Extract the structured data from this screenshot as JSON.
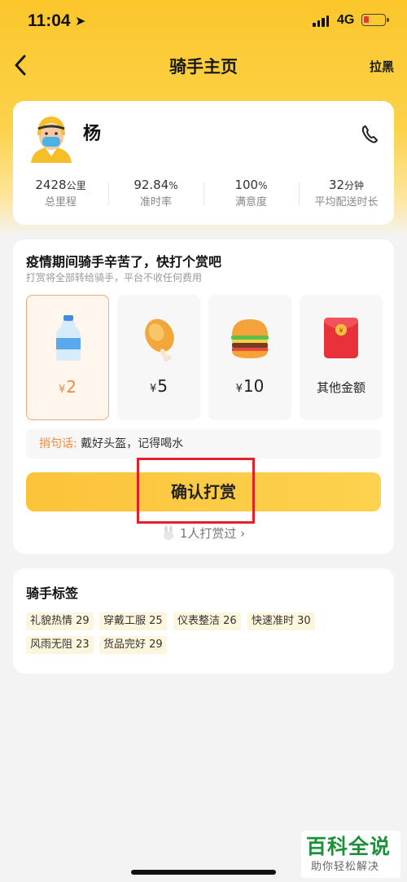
{
  "status_bar": {
    "time": "11:04",
    "network": "4G",
    "battery_color": "#e53935"
  },
  "nav": {
    "title": "骑手主页",
    "right_label": "拉黑"
  },
  "rider": {
    "name": "杨",
    "stats": [
      {
        "value": "2428",
        "unit": "公里",
        "label": "总里程"
      },
      {
        "value": "92.84",
        "unit": "%",
        "label": "准时率"
      },
      {
        "value": "100",
        "unit": "%",
        "label": "满意度"
      },
      {
        "value": "32",
        "unit": "分钟",
        "label": "平均配送时长"
      }
    ]
  },
  "tip": {
    "heading": "疫情期间骑手辛苦了，快打个赏吧",
    "subheading": "打赏将全部转给骑手，平台不收任何费用",
    "options": [
      {
        "icon": "water-bottle-icon",
        "currency": "¥",
        "amount": "2",
        "selected": true
      },
      {
        "icon": "chicken-leg-icon",
        "currency": "¥",
        "amount": "5",
        "selected": false
      },
      {
        "icon": "burger-icon",
        "currency": "¥",
        "amount": "10",
        "selected": false
      },
      {
        "icon": "red-envelope-icon",
        "label": "其他金额",
        "selected": false
      }
    ],
    "message_key": "捎句话:",
    "message_text": "戴好头盔，记得喝水",
    "confirm_label": "确认打赏",
    "tipped_count_label": "1人打赏过",
    "tipped_chevron": "›"
  },
  "tags": {
    "heading": "骑手标签",
    "items": [
      "礼貌热情 29",
      "穿戴工服 25",
      "仪表整洁 26",
      "快速准时 30",
      "风雨无阻 23",
      "货品完好 29"
    ]
  },
  "watermark": {
    "title": "百科全说",
    "subtitle": "助你轻松解决"
  },
  "colors": {
    "accent": "#fbc62a",
    "selected_border": "#f4a879",
    "selected_text": "#f08a3c",
    "highlight_box": "#e0202a"
  }
}
